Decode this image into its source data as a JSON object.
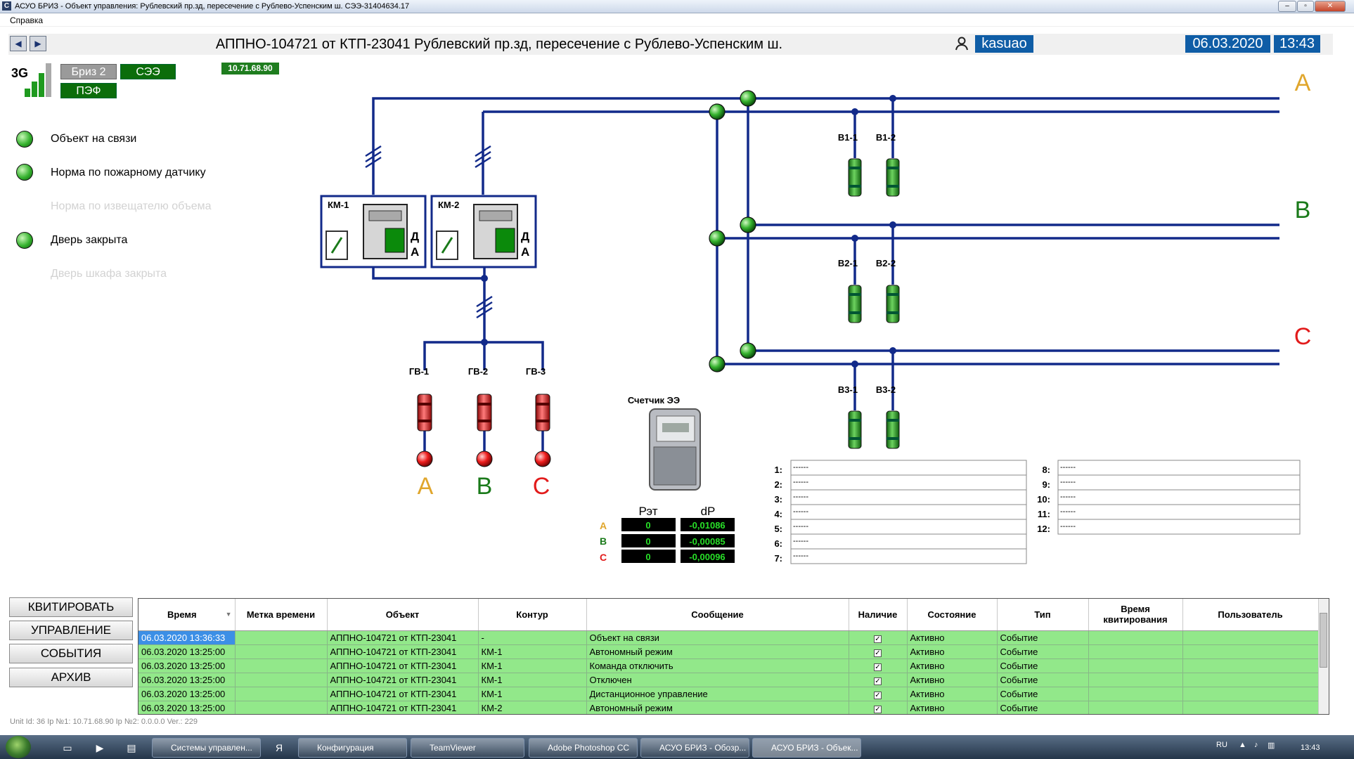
{
  "window": {
    "title": "АСУО БРИЗ - Объект управления: Рублевский пр.зд, пересечение с Рублево-Успенским ш. СЭЭ-31404634.17",
    "icon": "app-icon",
    "minimize": "–",
    "maximize": "▫",
    "close": "✕"
  },
  "menu": {
    "help": "Справка"
  },
  "header": {
    "back": "◀",
    "forward": "▶",
    "title": "АППНО-104721 от КТП-23041 Рублевский пр.зд, пересечение с Рублево-Успенским ш.",
    "user": "kasuao",
    "date": "06.03.2020",
    "time": "13:43"
  },
  "device": {
    "network": "3G",
    "labels": [
      "Бриз 2",
      "СЭЭ",
      "ПЭФ"
    ],
    "ip": "10.71.68.90"
  },
  "colors": {
    "A": "#e0a62c",
    "B": "#1a7a1a",
    "C": "#e21b1b",
    "bus": "#122a8a"
  },
  "status": [
    {
      "label": "Объект на связи",
      "active": true
    },
    {
      "label": "Норма по пожарному датчику",
      "active": true
    },
    {
      "label": "Норма по извещателю объема",
      "active": false
    },
    {
      "label": "Дверь закрыта",
      "active": true
    },
    {
      "label": "Дверь шкафа закрыта",
      "active": false
    }
  ],
  "scheme": {
    "phases": [
      "A",
      "B",
      "C"
    ],
    "contactors": [
      {
        "label": "КМ-1",
        "mode_top": "Д",
        "mode_bottom": "А"
      },
      {
        "label": "КМ-2",
        "mode_top": "Д",
        "mode_bottom": "А"
      }
    ],
    "main_fuses": [
      "ГВ-1",
      "ГВ-2",
      "ГВ-3"
    ],
    "feeders": [
      "В1-1",
      "В1-2",
      "В2-1",
      "В2-2",
      "В3-1",
      "В3-2"
    ],
    "meter_label": "Счетчик ЭЭ"
  },
  "meter": {
    "col_p": "Рэт",
    "col_dp": "dP",
    "rows": [
      {
        "phase": "A",
        "p": "0",
        "dp": "-0,01086"
      },
      {
        "phase": "B",
        "p": "0",
        "dp": "-0,00085"
      },
      {
        "phase": "C",
        "p": "0",
        "dp": "-0,00096"
      }
    ]
  },
  "channels": [
    {
      "n": "1:",
      "v": "------"
    },
    {
      "n": "2:",
      "v": "------"
    },
    {
      "n": "3:",
      "v": "------"
    },
    {
      "n": "4:",
      "v": "------"
    },
    {
      "n": "5:",
      "v": "------"
    },
    {
      "n": "6:",
      "v": "------"
    },
    {
      "n": "7:",
      "v": "------"
    },
    {
      "n": "8:",
      "v": "------"
    },
    {
      "n": "9:",
      "v": "------"
    },
    {
      "n": "10:",
      "v": "------"
    },
    {
      "n": "11:",
      "v": "------"
    },
    {
      "n": "12:",
      "v": "------"
    }
  ],
  "buttons": [
    "КВИТИРОВАТЬ",
    "УПРАВЛЕНИЕ",
    "СОБЫТИЯ",
    "АРХИВ"
  ],
  "events": {
    "columns": [
      "Время",
      "Метка времени",
      "Объект",
      "Контур",
      "Сообщение",
      "Наличие",
      "Состояние",
      "Тип",
      "Время квитирования",
      "Пользователь"
    ],
    "rows": [
      {
        "time": "06.03.2020 13:36:33",
        "mark": "",
        "object": "АППНО-104721 от КТП-23041",
        "contour": "-",
        "message": "Объект на связи",
        "present": true,
        "state": "Активно",
        "type": "Событие",
        "ack": "",
        "user": ""
      },
      {
        "time": "06.03.2020 13:25:00",
        "mark": "",
        "object": "АППНО-104721 от КТП-23041",
        "contour": "КМ-1",
        "message": "Автономный режим",
        "present": true,
        "state": "Активно",
        "type": "Событие",
        "ack": "",
        "user": ""
      },
      {
        "time": "06.03.2020 13:25:00",
        "mark": "",
        "object": "АППНО-104721 от КТП-23041",
        "contour": "КМ-1",
        "message": "Команда отключить",
        "present": true,
        "state": "Активно",
        "type": "Событие",
        "ack": "",
        "user": ""
      },
      {
        "time": "06.03.2020 13:25:00",
        "mark": "",
        "object": "АППНО-104721 от КТП-23041",
        "contour": "КМ-1",
        "message": "Отключен",
        "present": true,
        "state": "Активно",
        "type": "Событие",
        "ack": "",
        "user": ""
      },
      {
        "time": "06.03.2020 13:25:00",
        "mark": "",
        "object": "АППНО-104721 от КТП-23041",
        "contour": "КМ-1",
        "message": "Дистанционное управление",
        "present": true,
        "state": "Активно",
        "type": "Событие",
        "ack": "",
        "user": ""
      },
      {
        "time": "06.03.2020 13:25:00",
        "mark": "",
        "object": "АППНО-104721 от КТП-23041",
        "contour": "КМ-2",
        "message": "Автономный режим",
        "present": true,
        "state": "Активно",
        "type": "Событие",
        "ack": "",
        "user": ""
      }
    ]
  },
  "statusline": "Unit Id: 36   Ip №1: 10.71.68.90   Ip №2: 0.0.0.0   Ver.: 229",
  "taskbar": {
    "items": [
      "Системы управлен...",
      "Конфигурация",
      "TeamViewer",
      "Adobe Photoshop CC",
      "АСУО БРИЗ - Обозр...",
      "АСУО БРИЗ - Объек..."
    ],
    "lang": "RU",
    "clock": "13:43"
  }
}
